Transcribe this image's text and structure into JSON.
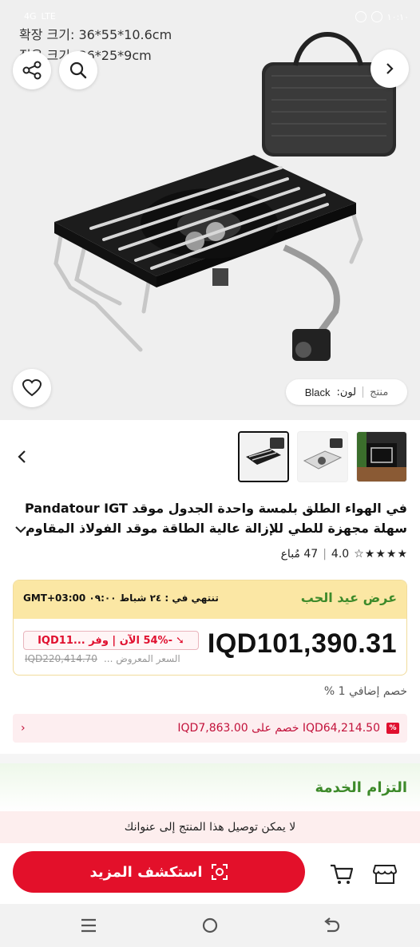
{
  "status": {
    "time": "١٠:١٠",
    "network": "4G",
    "signal": "LTE"
  },
  "hero": {
    "spec_lines": [
      "확장 크기: 36*55*10.6cm",
      "접은 크기: 36*25*9cm"
    ],
    "color_chip": {
      "label": "منتج",
      "color_label": "لون:",
      "color_value": "Black"
    }
  },
  "title": {
    "line1": "في الهواء الطلق بلمسة واحدة الجدول موقد Pandatour IGT",
    "line2": "سهلة مجهزة للطي للإزالة عالية الطاقة موقد الفولاذ المقاوم"
  },
  "rating": {
    "score": "4.0",
    "sold": "47 مُباع",
    "stars": 4
  },
  "promo": {
    "name": "عرض عيد الحب",
    "timer": "تنتهي في : ٢٤ شباط ٠٩:٠٠ GMT+03:00",
    "price": "IQD101,390.31",
    "discount_badge": "-54% الآن | وفر ...IQD11",
    "original_label": "السعر المعروض ...",
    "original_price": "IQD220,414.70"
  },
  "extra_discount": "خصم إضافي 1 %",
  "coupon": {
    "text": "IQD64,214.50 خصم على IQD7,863.00",
    "badge": "%"
  },
  "service": {
    "title": "التزام الخدمة"
  },
  "notice": "لا يمكن توصيل هذا المنتج إلى عنوانك",
  "actions": {
    "cta_label": "استكشف المزيد"
  },
  "colors": {
    "accent": "#e3102a",
    "promo_bg": "#fbe7a4",
    "promo_text": "#3d8a2a"
  }
}
